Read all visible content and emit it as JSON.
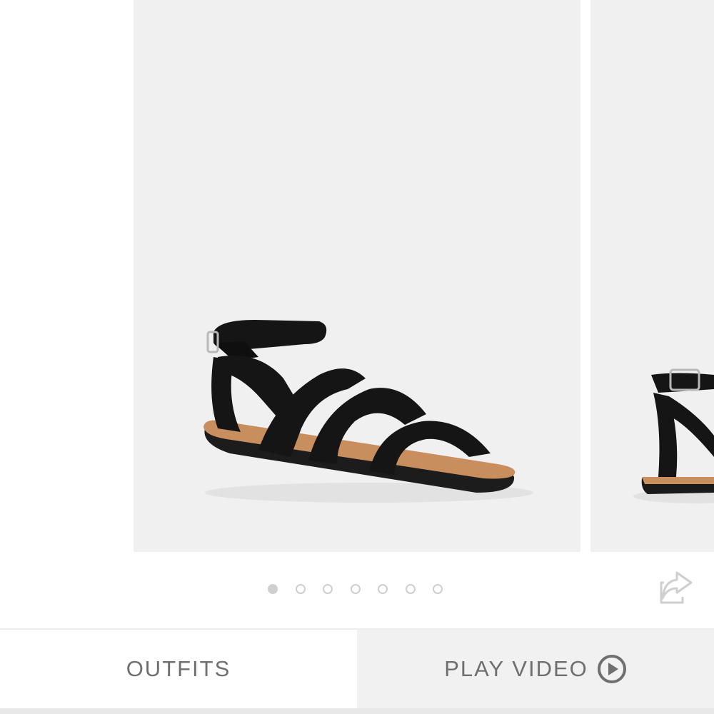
{
  "carousel": {
    "images": [
      {
        "icon": "black-strappy-sandal-image"
      },
      {
        "icon": "black-strappy-sandal-image-partial"
      }
    ],
    "dots_total": 7,
    "active_dot": 1
  },
  "share": {
    "icon": "share-icon"
  },
  "actions": {
    "outfits_label": "OUTFITS",
    "play_video_label": "PLAY VIDEO",
    "play_icon": "play-circle-icon"
  },
  "colors": {
    "image_background": "#f0f0f0",
    "label_text": "#6f6f6f",
    "dot": "#cfcfcf",
    "video_button_background": "#f1f1f1"
  }
}
